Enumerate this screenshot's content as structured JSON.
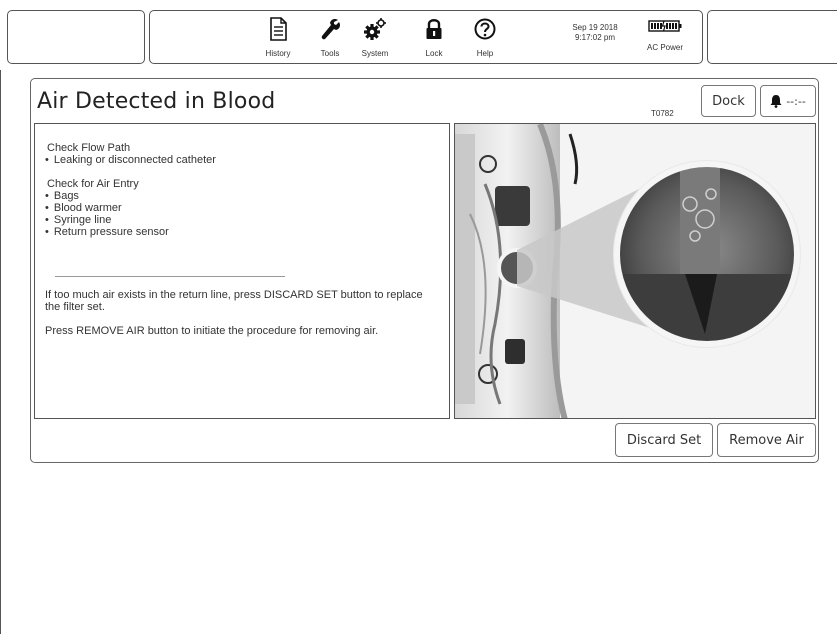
{
  "topbar": {
    "nav": [
      {
        "label": "History",
        "icon": "document-icon"
      },
      {
        "label": "Tools",
        "icon": "wrench-icon"
      },
      {
        "label": "System",
        "icon": "gears-icon"
      },
      {
        "label": "Lock",
        "icon": "lock-icon"
      },
      {
        "label": "Help",
        "icon": "question-circle-icon"
      }
    ],
    "date": "Sep 19 2018",
    "time": "9:17:02 pm",
    "power_label": "AC Power"
  },
  "alarm": {
    "title": "Air Detected in Blood",
    "code": "T0782",
    "dock_label": "Dock",
    "bell_status": "--:--",
    "flow_heading": "Check Flow Path",
    "flow_items": [
      "Leaking or disconnected catheter"
    ],
    "air_heading": "Check for Air Entry",
    "air_items": [
      "Bags",
      "Blood warmer",
      "Syringe line",
      "Return pressure sensor"
    ],
    "para1": "If too much air exists in the return line, press DISCARD SET button to replace the filter set.",
    "para2": "Press REMOVE AIR button to initiate the procedure for removing air.",
    "discard_label": "Discard Set",
    "remove_label": "Remove Air"
  },
  "colors": {
    "border": "#555555",
    "text": "#333333",
    "background": "#ffffff"
  }
}
